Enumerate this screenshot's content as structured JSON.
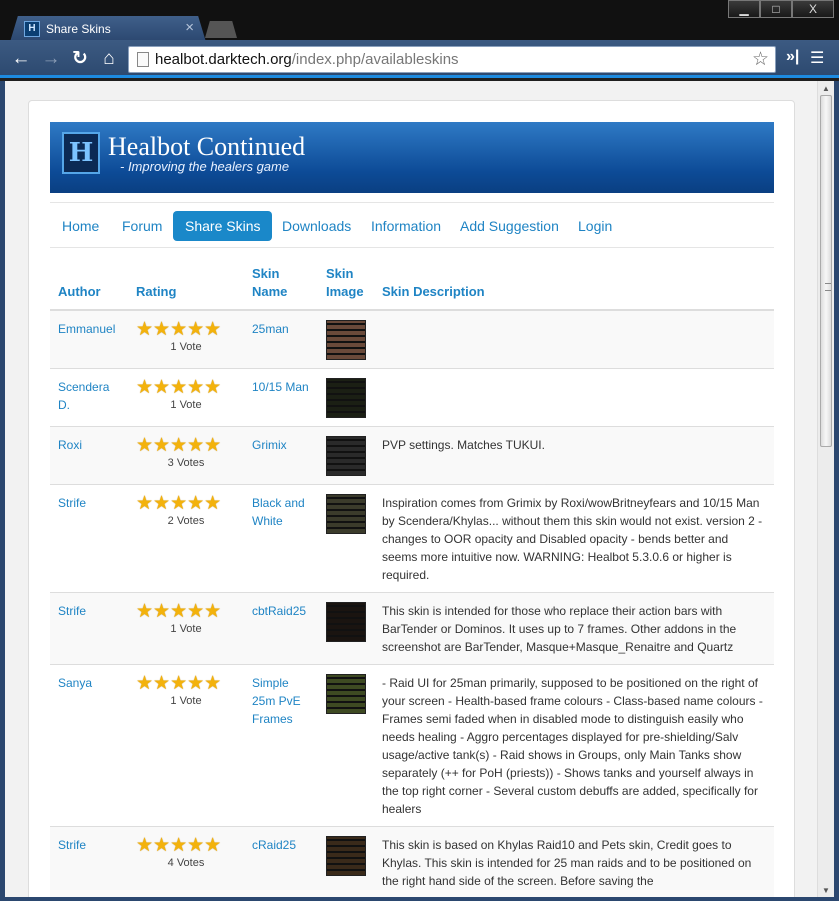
{
  "browser": {
    "tab_title": "Share Skins",
    "tab_close": "×",
    "url_host": "healbot.darktech.org",
    "url_path": "/index.php/availableskins",
    "win_minimize": "▁",
    "win_maximize": "□",
    "win_close": "X",
    "ext_label": "»|",
    "menu_label": "☰"
  },
  "site": {
    "title": "Healbot Continued",
    "tagline": "- Improving the healers game",
    "logo_glyph": "H"
  },
  "nav": [
    {
      "label": "Home"
    },
    {
      "label": "Forum"
    },
    {
      "label": "Share Skins"
    },
    {
      "label": "Downloads"
    },
    {
      "label": "Information"
    },
    {
      "label": "Add Suggestion"
    },
    {
      "label": "Login"
    }
  ],
  "table": {
    "headers": {
      "author": "Author",
      "rating": "Rating",
      "skin_name": "Skin Name",
      "skin_image": "Skin Image",
      "skin_description": "Skin Description"
    },
    "rows": [
      {
        "author": "Emmanuel",
        "stars": 5,
        "votes": "1 Vote",
        "name": "25man",
        "thumb_color": "#6a4a3a",
        "description": ""
      },
      {
        "author": "Scendera D.",
        "stars": 5,
        "votes": "1 Vote",
        "name": "10/15 Man",
        "thumb_color": "#1b1f14",
        "description": ""
      },
      {
        "author": "Roxi",
        "stars": 5,
        "votes": "3 Votes",
        "name": "Grimix",
        "thumb_color": "#2a2a2a",
        "description": "PVP settings. Matches TUKUI."
      },
      {
        "author": "Strife",
        "stars": 5,
        "votes": "2 Votes",
        "name": "Black and White",
        "thumb_color": "#3b3b2b",
        "description": "Inspiration comes from Grimix by Roxi/wowBritneyfears and 10/15 Man by Scendera/Khylas... without them this skin would not exist. version 2 - changes to OOR opacity and Disabled opacity - bends better and seems more intuitive now. WARNING: Healbot 5.3.0.6 or higher is required."
      },
      {
        "author": "Strife",
        "stars": 5,
        "votes": "1 Vote",
        "name": "cbtRaid25",
        "thumb_color": "#1a1410",
        "description": "This skin is intended for those who replace their action bars with BarTender or Dominos. It uses up to 7 frames. Other addons in the screenshot are BarTender, Masque+Masque_Renaitre and Quartz"
      },
      {
        "author": "Sanya",
        "stars": 5,
        "votes": "1 Vote",
        "name": "Simple 25m PvE Frames",
        "thumb_color": "#3e4a22",
        "description": "- Raid UI for 25man primarily, supposed to be positioned on the right of your screen - Health-based frame colours - Class-based name colours - Frames semi faded when in disabled mode to distinguish easily who needs healing - Aggro percentages displayed for pre-shielding/Salv usage/active tank(s) - Raid shows in Groups, only Main Tanks show separately (++ for PoH (priests)) - Shows tanks and yourself always in the top right corner - Several custom debuffs are added, specifically for healers"
      },
      {
        "author": "Strife",
        "stars": 5,
        "votes": "4 Votes",
        "name": "cRaid25",
        "thumb_color": "#3a2a1a",
        "description": "This skin is based on Khylas Raid10 and Pets skin, Credit goes to Khylas. This skin is intended for 25 man raids and to be positioned on the right hand side of the screen. Before saving the"
      }
    ]
  },
  "colors": {
    "link": "#1f84c4",
    "active_nav": "#1a88c9",
    "star": "#f3b20c",
    "banner": "#0d4b97"
  }
}
